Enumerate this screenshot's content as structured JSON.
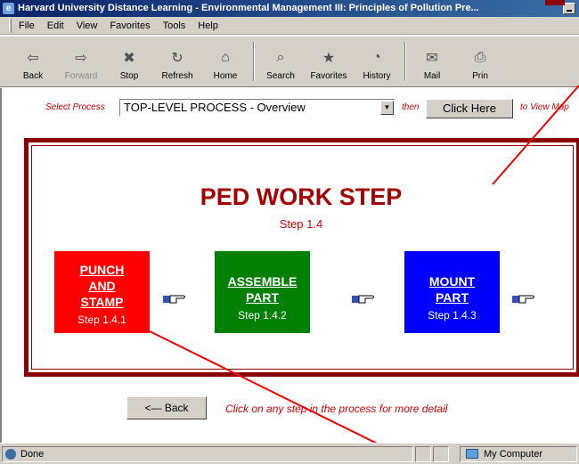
{
  "window": {
    "title": "Harvard University Distance Learning - Environmental Management III: Principles of Pollution Pre..."
  },
  "menu": [
    "File",
    "Edit",
    "View",
    "Favorites",
    "Tools",
    "Help"
  ],
  "toolbar": {
    "buttons": [
      {
        "label": "Back",
        "icon": "back-arrow-icon"
      },
      {
        "label": "Forward",
        "icon": "forward-arrow-icon"
      },
      {
        "label": "Stop",
        "icon": "stop-icon"
      },
      {
        "label": "Refresh",
        "icon": "refresh-icon"
      },
      {
        "label": "Home",
        "icon": "home-icon"
      },
      {
        "label": "Search",
        "icon": "search-icon"
      },
      {
        "label": "Favorites",
        "icon": "favorites-icon"
      },
      {
        "label": "History",
        "icon": "history-icon"
      },
      {
        "label": "Mail",
        "icon": "mail-icon"
      },
      {
        "label": "Prin",
        "icon": "print-icon"
      }
    ]
  },
  "selector": {
    "label": "Select Process",
    "value": "TOP-LEVEL PROCESS - Overview",
    "then_label": "then",
    "button_label": "Click Here",
    "suffix_label": "to View Map"
  },
  "main": {
    "title": "PED WORK STEP",
    "step": "Step 1.4",
    "steps": [
      {
        "line1": "PUNCH",
        "line2": "AND",
        "line3": "STAMP",
        "number": "Step 1.4.1",
        "color": "#ff0000"
      },
      {
        "line1": "ASSEMBLE",
        "line2": "PART",
        "number": "Step 1.4.2",
        "color": "#008000"
      },
      {
        "line1": "MOUNT",
        "line2": "PART",
        "number": "Step 1.4.3",
        "color": "#0000ff"
      }
    ]
  },
  "footer": {
    "back_label": "<— Back",
    "hint": "Click on any step in the process for more detail"
  },
  "status": {
    "text": "Done",
    "zone": "My Computer"
  },
  "colors": {
    "accent_red": "#cc0000",
    "frame": "#8b0000",
    "title_bar": "#0a246a"
  }
}
